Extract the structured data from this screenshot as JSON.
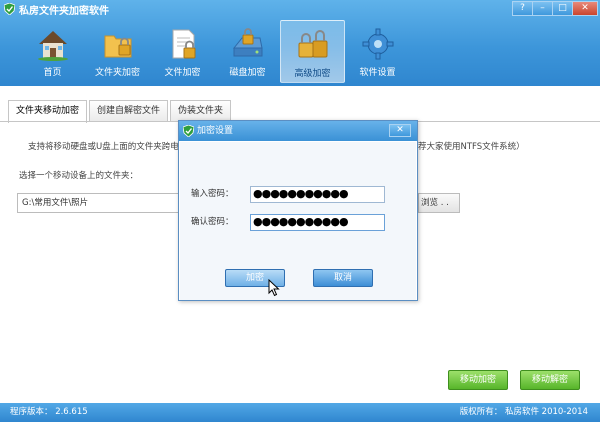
{
  "app": {
    "title": "私房文件夹加密软件"
  },
  "window_controls": [
    "?",
    "–",
    "□",
    "✕"
  ],
  "nav": [
    {
      "label": "首页",
      "icon": "house-icon"
    },
    {
      "label": "文件夹加密",
      "icon": "folder-lock-icon"
    },
    {
      "label": "文件加密",
      "icon": "document-lock-icon"
    },
    {
      "label": "磁盘加密",
      "icon": "disk-lock-icon"
    },
    {
      "label": "高级加密",
      "icon": "padlock-icon",
      "active": true
    },
    {
      "label": "软件设置",
      "icon": "gear-icon"
    }
  ],
  "tabs": [
    {
      "label": "文件夹移动加密",
      "active": true
    },
    {
      "label": "创建自解密文件"
    },
    {
      "label": "伪装文件夹"
    }
  ],
  "main": {
    "description": "支持将移动硬盘或U盘上面的文件夹跨电",
    "description_tail": "荐大家使用NTFS文件系统）",
    "select_label": "选择一个移动设备上的文件夹：",
    "path_value": "G:\\常用文件\\照片",
    "browse_label": "浏览 . .",
    "move_encrypt_label": "移动加密",
    "move_decrypt_label": "移动解密"
  },
  "dialog": {
    "title": "加密设置",
    "password_label": "输入密码：",
    "password_value": "●●●●●●●●●●●",
    "confirm_label": "确认密码：",
    "confirm_value": "●●●●●●●●●●●",
    "ok_label": "加密",
    "cancel_label": "取消"
  },
  "status": {
    "version": "程序版本： 2.6.615",
    "copyright": "版权所有： 私房软件 2010-2014"
  },
  "colors": {
    "header_blue": "#3d96da",
    "green_button": "#57b52a",
    "dialog_button": "#3d8ed6"
  }
}
